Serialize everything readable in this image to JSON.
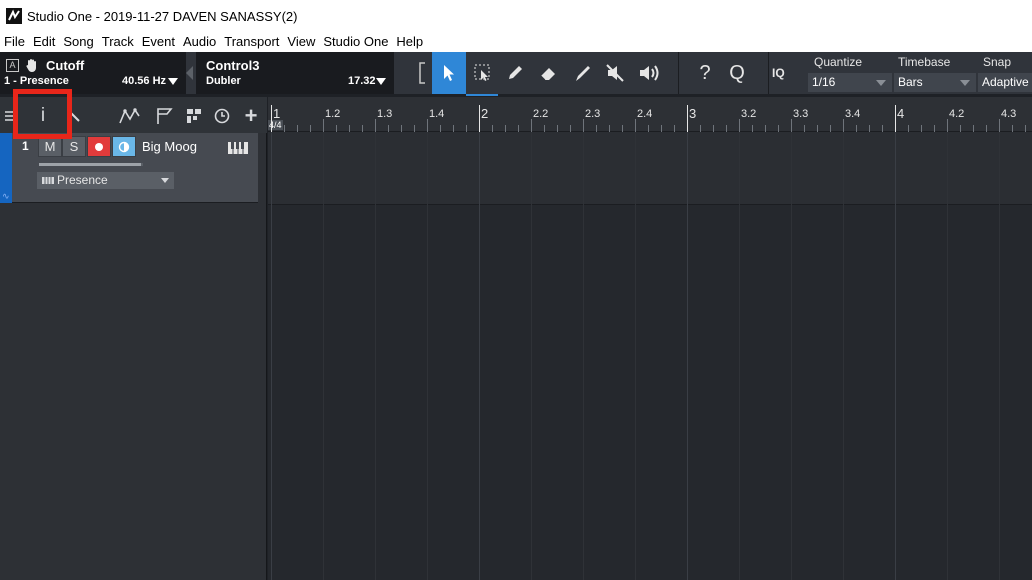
{
  "window": {
    "title": "Studio One - 2019-11-27 DAVEN SANASSY(2)"
  },
  "menu": [
    "File",
    "Edit",
    "Song",
    "Track",
    "Event",
    "Audio",
    "Transport",
    "View",
    "Studio One",
    "Help"
  ],
  "controls": {
    "first": {
      "badge": "A",
      "name": "Cutoff",
      "sub": "1 - Presence",
      "value": "40.56 Hz"
    },
    "second": {
      "name": "Control3",
      "sub": "Dubler",
      "value": "17.32"
    }
  },
  "tools": [
    "select-tool",
    "range-tool",
    "paint-tool",
    "eraser-tool",
    "paint-brush-tool",
    "mute-tool",
    "listen-tool"
  ],
  "help": {
    "question": "?",
    "search": "Q",
    "iq": "IQ"
  },
  "quantize": {
    "label": "Quantize",
    "value": "1/16"
  },
  "timebase": {
    "label": "Timebase",
    "value": "Bars"
  },
  "snap": {
    "label": "Snap",
    "value": "Adaptive"
  },
  "ruler": {
    "timesig": "4/4",
    "marks": [
      "1",
      "1.2",
      "1.3",
      "1.4",
      "2",
      "2.2",
      "2.3",
      "2.4",
      "3",
      "3.2",
      "3.3",
      "3.4",
      "4",
      "4.2",
      "4.3"
    ]
  },
  "track": {
    "number": "1",
    "mute": "M",
    "solo": "S",
    "name": "Big Moog",
    "instrument": "Presence",
    "volume": 0.98
  },
  "panel": {
    "inspector": "i",
    "add": "+"
  },
  "colors": {
    "accent": "#2f87d7",
    "highlight": "#e8261a",
    "track": "#1565c0"
  }
}
